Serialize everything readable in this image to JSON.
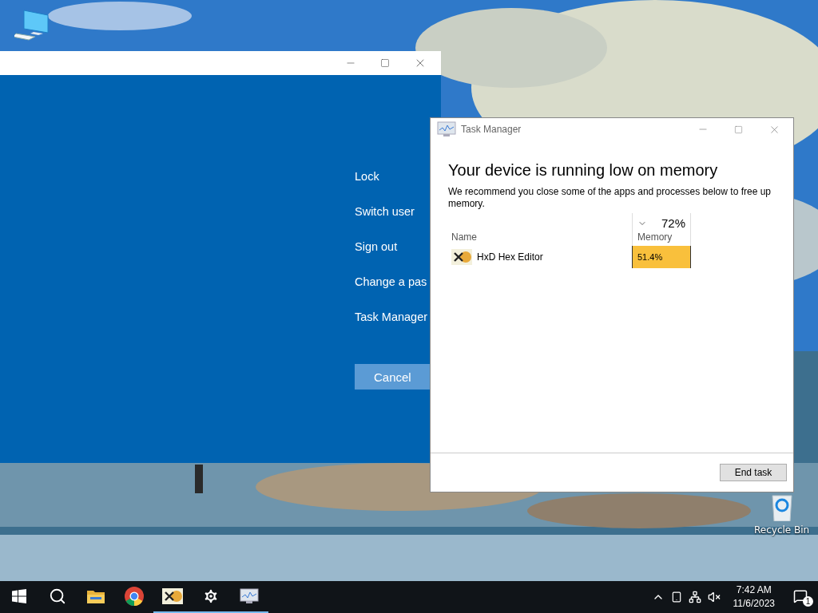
{
  "desktop_icons": [
    {
      "kind": "computer"
    },
    {
      "kind": "recycle",
      "label": "Recycle Bin"
    }
  ],
  "security_screen": {
    "options": [
      "Lock",
      "Switch user",
      "Sign out",
      "Change a pas",
      "Task Manager"
    ],
    "cancel": "Cancel"
  },
  "task_manager": {
    "title": "Task Manager",
    "heading": "Your device is running low on memory",
    "message": "We recommend you close some of the apps and processes below to free up memory.",
    "columns": [
      {
        "label": "Name"
      },
      {
        "label": "Memory",
        "total": "72%",
        "sorted": true
      }
    ],
    "rows": [
      {
        "name": "HxD Hex Editor",
        "memory": "51.4%"
      }
    ],
    "button": "End task"
  },
  "taskbar": {
    "apps": [
      {
        "kind": "start",
        "running": false
      },
      {
        "kind": "search",
        "running": false
      },
      {
        "kind": "folder",
        "running": false
      },
      {
        "kind": "browser",
        "running": false
      },
      {
        "kind": "hex",
        "running": true
      },
      {
        "kind": "settings",
        "running": true
      },
      {
        "kind": "monitor",
        "running": true
      }
    ],
    "time": "7:42 AM",
    "date": "11/6/2023",
    "notifications": "1"
  }
}
